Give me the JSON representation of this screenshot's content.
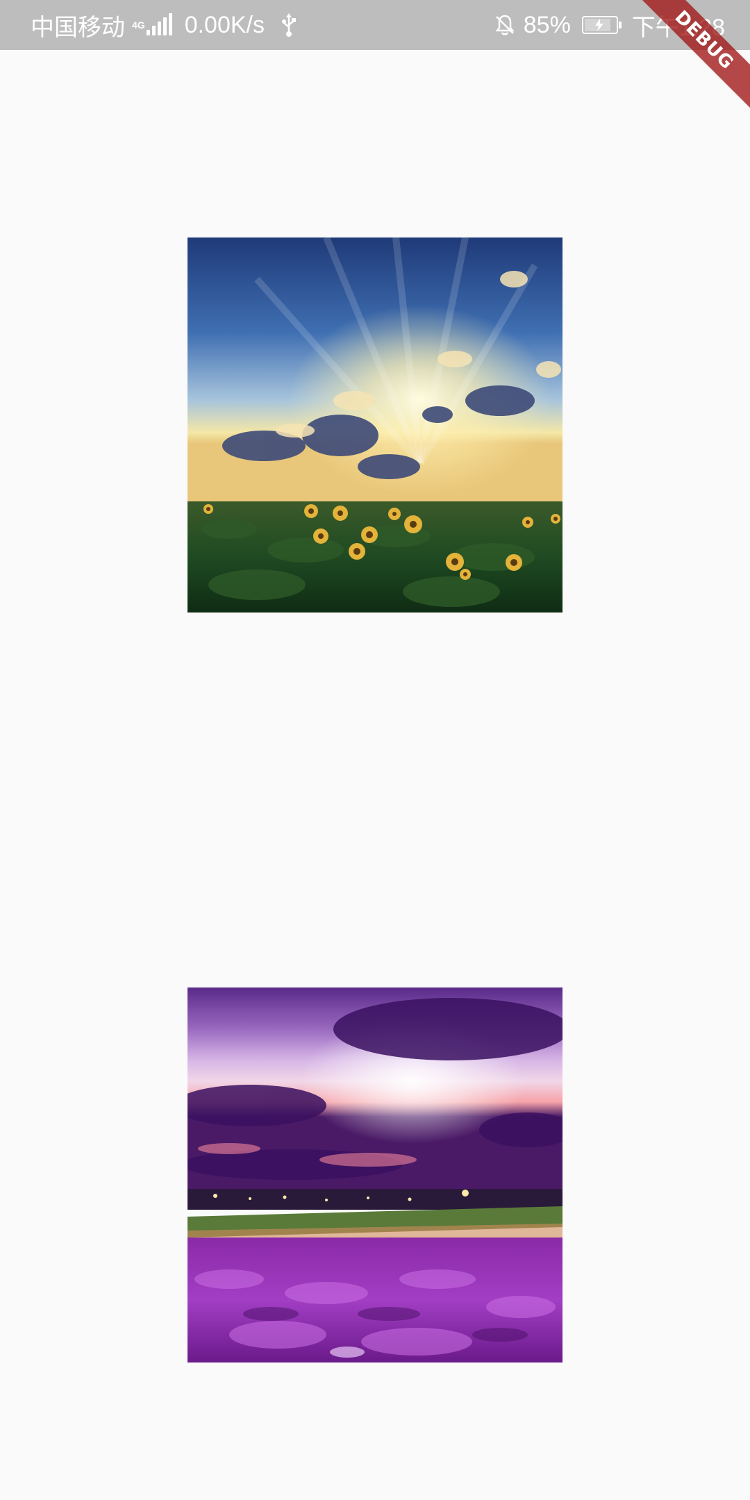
{
  "status_bar": {
    "carrier": "中国移动",
    "network_type": "4G",
    "net_speed": "0.00K/s",
    "battery": "85%",
    "battery_level": 0.85,
    "time": "下午1:28",
    "icons": [
      "signal-icon",
      "usb-icon",
      "bell-off-icon",
      "battery-charging-icon"
    ],
    "text_color": "#ffffff",
    "background": "#bdbdbd"
  },
  "debug_banner": {
    "label": "DEBUG",
    "color": "#a01414"
  },
  "images": [
    {
      "name": "sunflower-field-image"
    },
    {
      "name": "lavender-field-image"
    }
  ],
  "colors": {
    "page_background": "#fafafa"
  }
}
